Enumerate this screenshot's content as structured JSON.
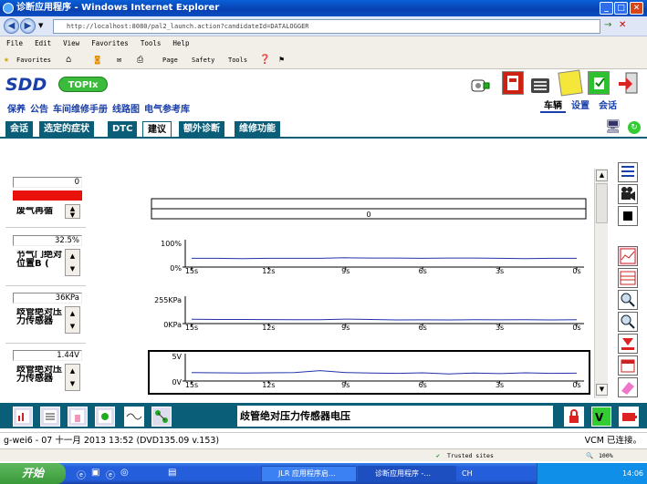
{
  "window": {
    "title": "诊断应用程序 - Windows Internet Explorer",
    "min": "_",
    "max": "□",
    "close": "✕"
  },
  "address": {
    "url": "http://localhost:8080/pal2_launch.action?candidateId=DATALOGGER",
    "go": "→",
    "x": "✕"
  },
  "menu": [
    "File",
    "Edit",
    "View",
    "Favorites",
    "Tools",
    "Help"
  ],
  "favbar": {
    "favorites": "Favorites",
    "items": [
      "Page",
      "Safety",
      "Tools"
    ]
  },
  "app": {
    "logo": "SDD",
    "topix": "TOPIx",
    "links": [
      "保养",
      "公告",
      "车间维修手册",
      "线路图",
      "电气参考库"
    ],
    "right_tabs": [
      "车辆",
      "设置",
      "会话"
    ],
    "tabs": [
      "会话",
      "选定的症状",
      "DTC",
      "建议",
      "额外诊断",
      "维修功能"
    ]
  },
  "params": [
    {
      "value": "0",
      "label": "废气再循",
      "bar": "0",
      "bar_color": "#e8120a"
    },
    {
      "value": "32.5%",
      "label": "节气门绝对位置B (",
      "ymax": "100%",
      "ymin": "0%"
    },
    {
      "value": "36KPa",
      "label": "歧管绝对压力传感器",
      "ymax": "255KPa",
      "ymin": "0KPa"
    },
    {
      "value": "1.44V",
      "label": "歧管绝对压力传感器",
      "ymax": "5V",
      "ymin": "0V"
    }
  ],
  "time_ticks": [
    "15s",
    "12s",
    "9s",
    "6s",
    "3s",
    "0s"
  ],
  "chart_data": [
    {
      "type": "line",
      "title": "",
      "y_range": [
        0,
        100
      ],
      "unit": "%",
      "x": [
        15,
        14,
        13,
        12,
        11,
        10,
        9,
        8,
        7,
        6,
        5,
        4,
        3,
        2,
        1,
        0
      ],
      "values": [
        32,
        32,
        31,
        32,
        32,
        32,
        34,
        33,
        33,
        32,
        33,
        33,
        32,
        31,
        32,
        32
      ]
    },
    {
      "type": "line",
      "title": "",
      "y_range": [
        0,
        255
      ],
      "unit": "KPa",
      "x": [
        15,
        14,
        13,
        12,
        11,
        10,
        9,
        8,
        7,
        6,
        5,
        4,
        3,
        2,
        1,
        0
      ],
      "values": [
        40,
        38,
        38,
        37,
        36,
        36,
        42,
        38,
        34,
        35,
        34,
        36,
        35,
        36,
        34,
        36
      ]
    },
    {
      "type": "line",
      "title": "",
      "y_range": [
        0,
        5
      ],
      "unit": "V",
      "x": [
        15,
        14,
        13,
        12,
        11,
        10,
        9,
        8,
        7,
        6,
        5,
        4,
        3,
        2,
        1,
        0
      ],
      "values": [
        1.55,
        1.5,
        1.45,
        1.5,
        1.55,
        1.9,
        1.55,
        1.45,
        1.4,
        1.5,
        1.3,
        1.45,
        1.35,
        1.5,
        1.4,
        1.44
      ]
    }
  ],
  "hint": "歧管绝对压力传感器电压",
  "status": {
    "left": "g-wei6 - 07 十一月 2013 13:52 (DVD135.09 v.153)",
    "right": "VCM 已连接。"
  },
  "iestatus": {
    "trusted": "Trusted sites",
    "zoom": "100%"
  },
  "taskbar": {
    "start": "开始",
    "tasks": [
      "JLR 应用程序启...",
      "诊断应用程序 -..."
    ],
    "lang": "CH",
    "time": "14:06"
  }
}
